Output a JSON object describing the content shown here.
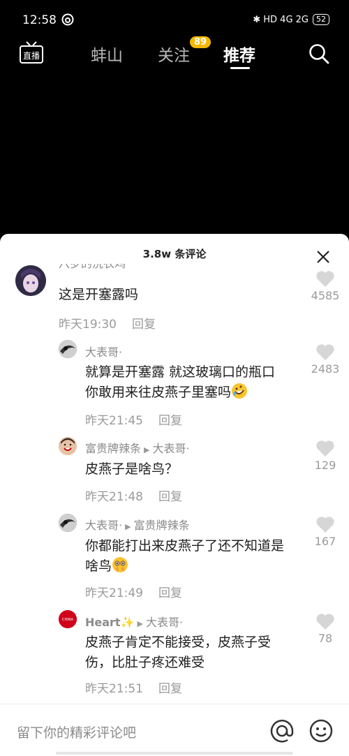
{
  "status_bar": {
    "time": "12:58",
    "app_icon": "netease-music-icon",
    "indicators": "✱ HD 4G 2G",
    "battery": "52"
  },
  "nav": {
    "live_label": "直播",
    "tabs": [
      {
        "label": "蚌山"
      },
      {
        "label": "关注"
      },
      {
        "label": "推荐"
      }
    ],
    "follow_badge": "89",
    "active_tab": "推荐"
  },
  "comments_panel": {
    "title": "3.8w 条评论",
    "comments": [
      {
        "author": "八岁的洗衣鸡",
        "text": "这是开塞露吗",
        "time": "昨天19:30",
        "reply": "回复",
        "likes": "4585"
      },
      {
        "author": "大表哥·",
        "text_line1": "就算是开塞露 就这玻璃口的瓶口",
        "text_line2": "你敢用来往皮燕子里塞吗",
        "emoji": "rofl-emoji",
        "time": "昨天21:45",
        "reply": "回复",
        "likes": "2483"
      },
      {
        "author": "富贵牌辣条",
        "reply_to": "大表哥·",
        "text": "皮燕子是啥鸟？",
        "time": "昨天21:48",
        "reply": "回复",
        "likes": "129"
      },
      {
        "author": "大表哥·",
        "reply_to": "富贵牌辣条",
        "text_line1": "你都能打出来皮燕子了还不知道是",
        "text_line2": "啥鸟",
        "emoji": "pleading-emoji",
        "time": "昨天21:49",
        "reply": "回复",
        "likes": "167"
      },
      {
        "author": "Heart",
        "author_sparkle": "✨",
        "reply_to": "大表哥·",
        "avatar_text": "CHINA",
        "text_line1": "皮燕子肯定不能接受，皮燕子受",
        "text_line2": "伤，比肚子疼还难受",
        "time": "昨天21:51",
        "reply": "回复",
        "likes": "78"
      }
    ]
  },
  "input_bar": {
    "placeholder": "留下你的精彩评论吧"
  },
  "colors": {
    "background": "#000000",
    "sheet": "#ffffff",
    "badge": "#f5b800",
    "muted_text": "#8a8a8a"
  }
}
